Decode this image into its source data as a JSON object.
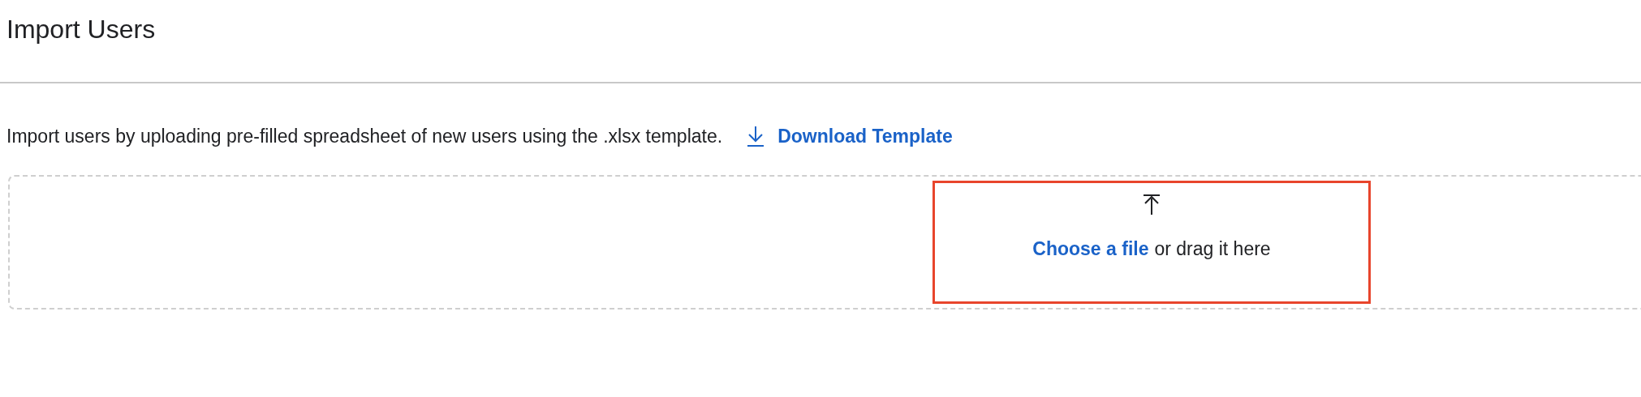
{
  "page": {
    "title": "Import Users"
  },
  "intro": {
    "text": "Import users by uploading pre-filled spreadsheet of new users using the .xlsx template.",
    "link": "Download Template"
  },
  "upload": {
    "link": "Choose a file",
    "hint": "or drag it here",
    "highlighted": true
  }
}
